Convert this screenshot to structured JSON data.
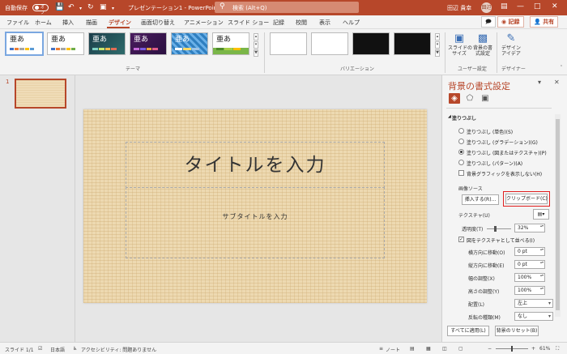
{
  "titlebar": {
    "autosave": "自動保存",
    "autosave_state": "オフ",
    "filename": "プレゼンテーション1 - PowerPoint",
    "search_placeholder": "検索 (Alt+Q)",
    "user": "田辺 貴幸",
    "avatar": "田辺",
    "accent": "#b7472a"
  },
  "tabs": [
    "ファイル",
    "ホーム",
    "挿入",
    "描画",
    "デザイン",
    "画面切り替え",
    "アニメーション",
    "スライド ショー",
    "記録",
    "校閲",
    "表示",
    "ヘルプ"
  ],
  "ribbon_actions": {
    "record": "記録",
    "share": "共有"
  },
  "ribbon": {
    "theme_sample": "亜あ",
    "groups": {
      "themes": "テーマ",
      "variants": "バリエーション",
      "customize": "ユーザー設定",
      "designer": "デザイナー"
    },
    "buttons": {
      "slide_size": "スライドの\nサイズ",
      "format_bg": "背景の書\n式設定",
      "design_ideas": "デザイン\nアイデア"
    }
  },
  "slide": {
    "number": "1",
    "title_placeholder": "タイトルを入力",
    "subtitle_placeholder": "サブタイトルを入力"
  },
  "pane": {
    "title": "背景の書式設定",
    "section": "塗りつぶし",
    "options": [
      "塗りつぶし (単色)(S)",
      "塗りつぶし (グラデーション)(G)",
      "塗りつぶし (図またはテクスチャ)(P)",
      "塗りつぶし (パターン)(A)"
    ],
    "selected_option": 2,
    "hide_graphics": "背景グラフィックを表示しない(H)",
    "image_source": "画像ソース",
    "insert_btn": "挿入する(R)...",
    "clipboard_btn": "クリップボード(C)",
    "texture": "テクスチャ(U)",
    "transparency_label": "透明度(T)",
    "transparency": "32%",
    "tile_label": "図をテクスチャとして並べる(I)",
    "tile_checked": true,
    "fields": [
      {
        "label": "横方向に移動(O)",
        "value": "0 pt"
      },
      {
        "label": "縦方向に移動(E)",
        "value": "0 pt"
      },
      {
        "label": "幅の調整(X)",
        "value": "100%"
      },
      {
        "label": "高さの調整(Y)",
        "value": "100%"
      }
    ],
    "align_label": "配置(L)",
    "align_value": "左上",
    "mirror_label": "反転の種類(M)",
    "mirror_value": "なし",
    "apply_all": "すべてに適用(L)",
    "reset": "背景のリセット(B)"
  },
  "status": {
    "slide": "スライド 1/1",
    "lang": "日本語",
    "access": "アクセシビリティ: 問題ありません",
    "notes": "ノート",
    "zoom": "61%"
  }
}
